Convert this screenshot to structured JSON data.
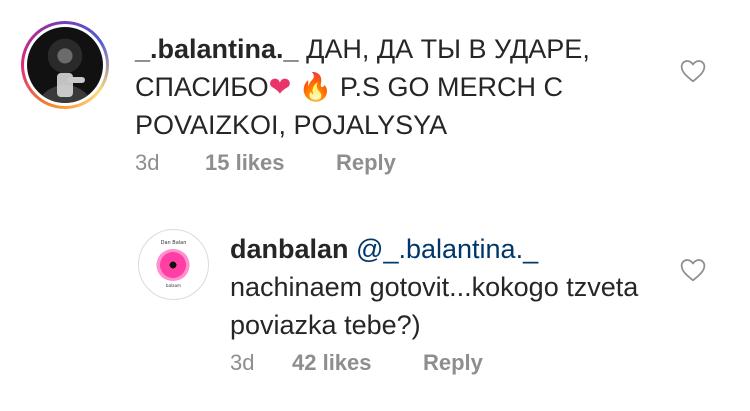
{
  "comments": [
    {
      "username": "_.balantina._",
      "text_part1": " ДАН, ДА ТЫ В УДАРЕ, СПАСИБО",
      "emoji_heart": "❤",
      "emoji_fire": "🔥",
      "text_part2": " P.S GO MERCH C POVAIZKOI, POJALYSYA",
      "time": "3d",
      "likes": "15 likes",
      "reply_label": "Reply"
    },
    {
      "username": "danbalan",
      "mention": "@_.balantina._",
      "text": " nachinaem gotovit...kokogo tzveta poviazka tebe?)",
      "time": "3d",
      "likes": "42 likes",
      "reply_label": "Reply",
      "avatar_brand": "Dan Balan",
      "avatar_bottom": "balaam"
    }
  ],
  "icons": {
    "like": "heart-outline-icon"
  },
  "colors": {
    "text": "#262626",
    "meta": "#8e8e8e",
    "mention": "#00376b"
  }
}
